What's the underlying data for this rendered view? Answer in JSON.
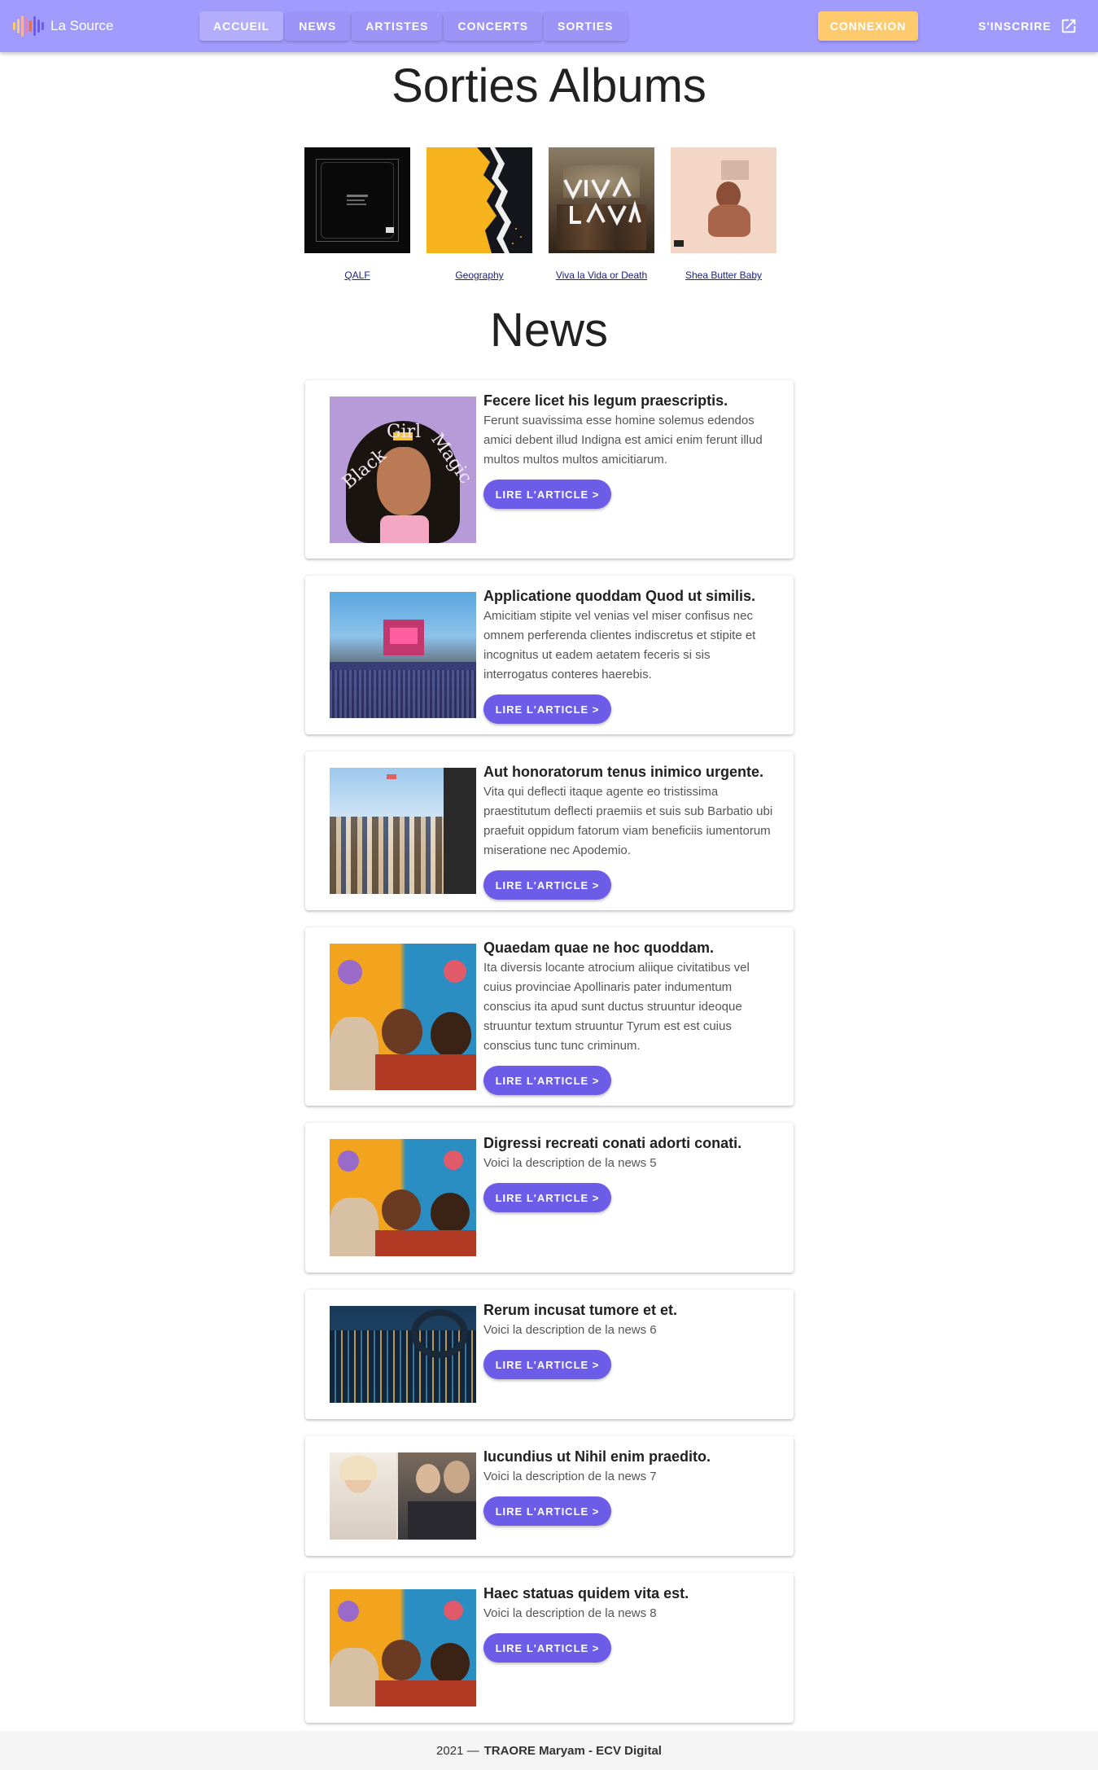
{
  "app": {
    "name": "La Source",
    "nav": [
      "ACCUEIL",
      "NEWS",
      "ARTISTES",
      "CONCERTS",
      "SORTIES"
    ],
    "active_tab": "ACCUEIL",
    "login_label": "CONNEXION",
    "signup_label": "S'INSCRIRE"
  },
  "albums": {
    "title": "Sorties Albums",
    "items": [
      {
        "title": "QALF"
      },
      {
        "title": "Geography"
      },
      {
        "title": "Viva la Vida or Death"
      },
      {
        "title": "Shea Butter Baby"
      }
    ]
  },
  "news": {
    "title": "News",
    "button_label": "LIRE L'ARTICLE >",
    "items": [
      {
        "title": "Fecere licet his legum praescriptis.",
        "description": "Ferunt suavissima esse homine solemus edendos amici debent illud Indigna est amici enim ferunt illud multos multos multos amicitiarum.",
        "image": "black-girl-magic-illustration"
      },
      {
        "title": "Applicatione quoddam Quod ut similis.",
        "description": "Amicitiam stipite vel venias vel miser confisus nec omnem perferenda clientes indiscretus et stipite et incognitus ut eadem aetatem feceris si sis interrogatus conteres haerebis.",
        "image": "festival-stage-crowd"
      },
      {
        "title": "Aut honoratorum tenus inimico urgente.",
        "description": "Vita qui deflecti itaque agente eo tristissima praestitutum deflecti praemiis et suis sub Barbatio ubi praefuit oppidum fatorum viam beneficiis iumentorum miseratione nec Apodemio.",
        "image": "festival-crowd-sunny"
      },
      {
        "title": "Quaedam quae ne hoc quoddam.",
        "description": "Ita diversis locante atrocium aliique civitatibus vel cuius provinciae Apollinaris pater indumentum conscius ita apud sunt ductus struuntur ideoque struuntur textum struuntur Tyrum est est cuius conscius tunc tunc criminum.",
        "image": "painted-faces-flowers"
      },
      {
        "title": "Digressi recreati conati adorti conati.",
        "description": "Voici la description de la news 5",
        "image": "painted-faces-flowers"
      },
      {
        "title": "Rerum incusat tumore et et.",
        "description": "Voici la description de la news 6",
        "image": "mixing-console-headphones"
      },
      {
        "title": "Iucundius ut Nihil enim praedito.",
        "description": "Voici la description de la news 7",
        "image": "artist-portraits"
      },
      {
        "title": "Haec statuas quidem vita est.",
        "description": "Voici la description de la news 8",
        "image": "painted-faces-flowers"
      }
    ]
  },
  "footer": {
    "year": "2021 —",
    "author": "TRAORE Maryam - ECV Digital"
  },
  "colors": {
    "appbar": "#a29bfe",
    "login": "#fdcb6e",
    "accent": "#6c5ce7"
  },
  "icons": [
    "equalizer-logo-icon",
    "open-in-new-icon"
  ]
}
